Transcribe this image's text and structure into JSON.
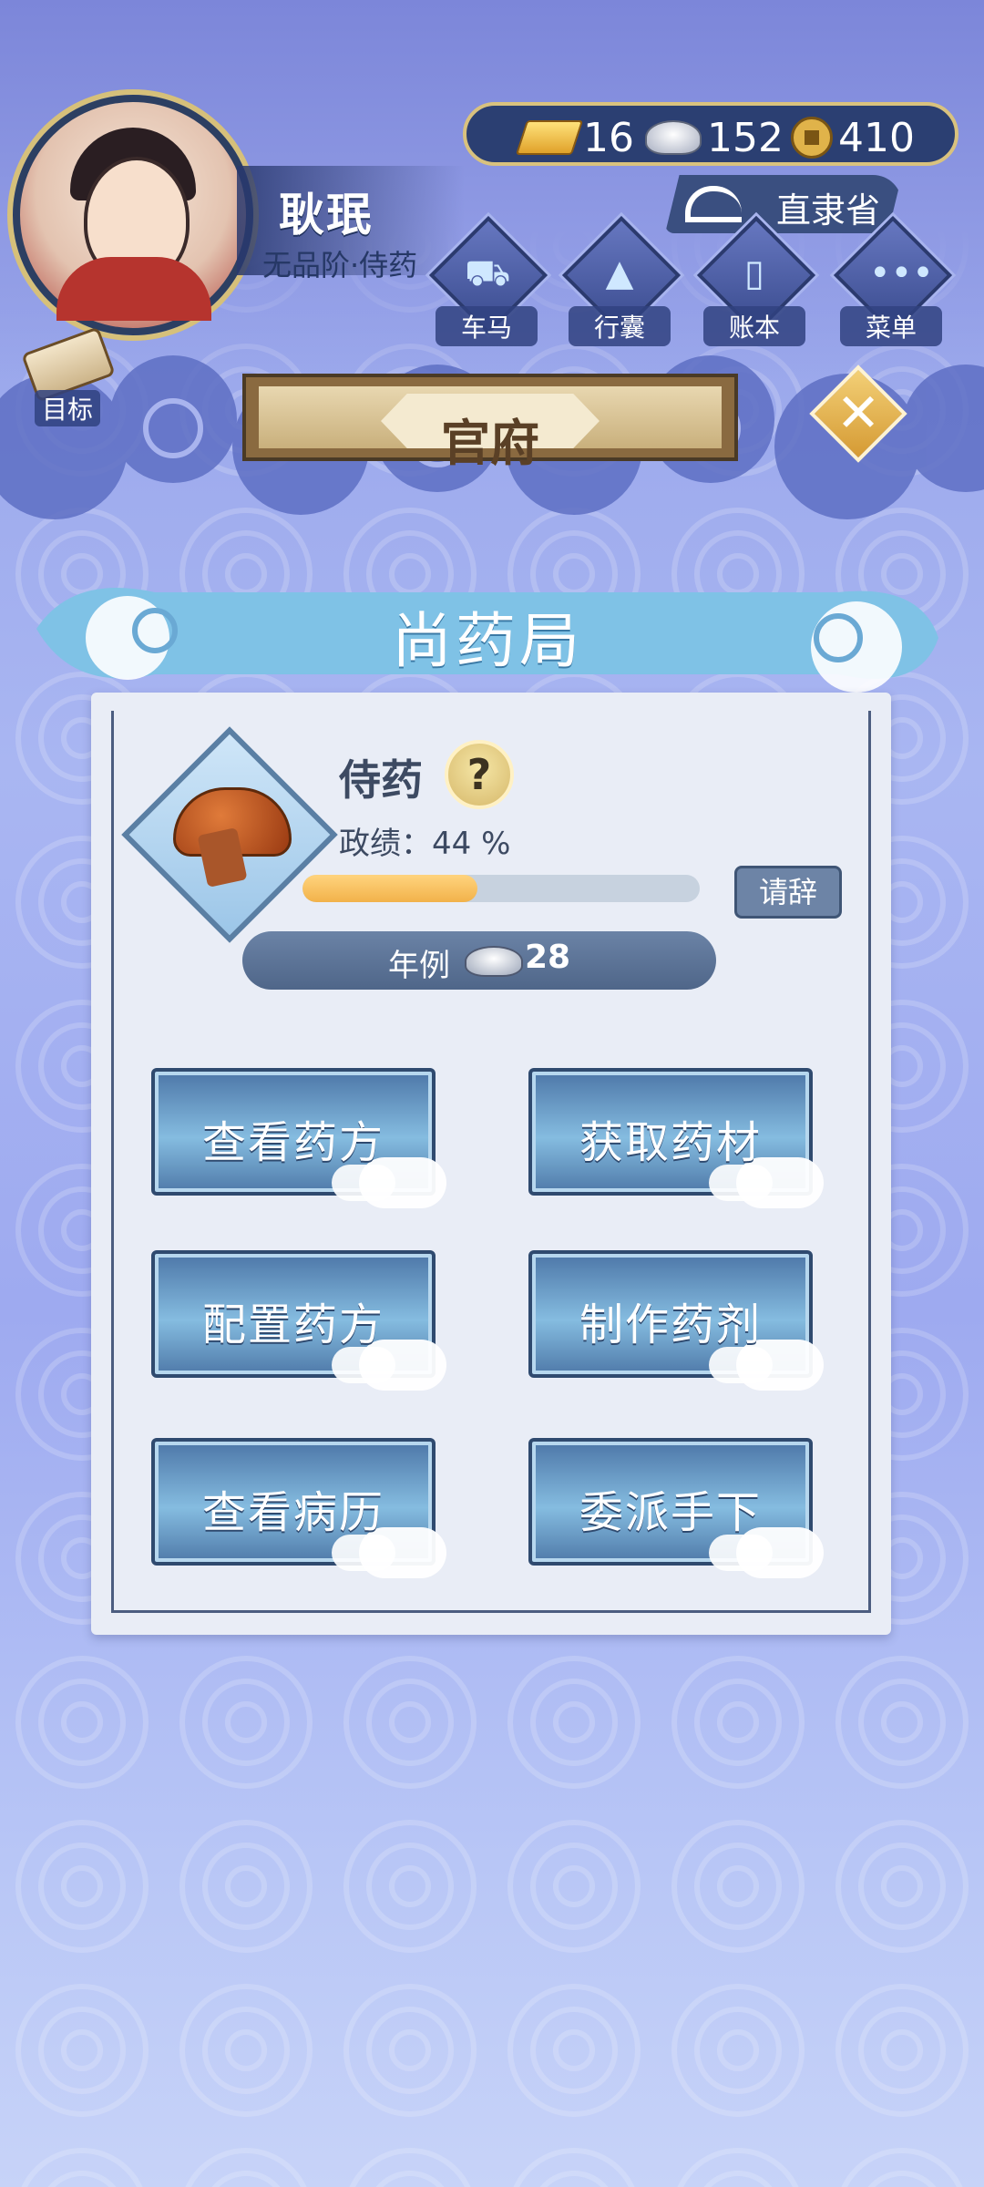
{
  "player": {
    "name": "耿珉",
    "rank": "无品阶·侍药"
  },
  "currency": {
    "gold": "16",
    "silver": "152",
    "copper": "410"
  },
  "location": {
    "label": "直隶省"
  },
  "quick_menu": [
    {
      "label": "车马",
      "icon": "carriage-icon"
    },
    {
      "label": "行囊",
      "icon": "bundle-icon"
    },
    {
      "label": "账本",
      "icon": "ledger-icon"
    },
    {
      "label": "菜单",
      "icon": "more-icon"
    }
  ],
  "target": {
    "label": "目标"
  },
  "page": {
    "title": "官府"
  },
  "department": {
    "title": "尚药局",
    "role": "侍药",
    "help_label": "?",
    "merit_text": "政绩：44 %",
    "merit_progress": 0.44,
    "resign_label": "请辞",
    "salary_label": "年例",
    "salary_value": "28"
  },
  "actions": [
    {
      "label": "查看药方"
    },
    {
      "label": "获取药材"
    },
    {
      "label": "配置药方"
    },
    {
      "label": "制作药剂"
    },
    {
      "label": "查看病历"
    },
    {
      "label": "委派手下"
    }
  ],
  "colors": {
    "accent_gold": "#d9c27e",
    "panel": "#e9edf6",
    "progress": "#f2b24a"
  }
}
